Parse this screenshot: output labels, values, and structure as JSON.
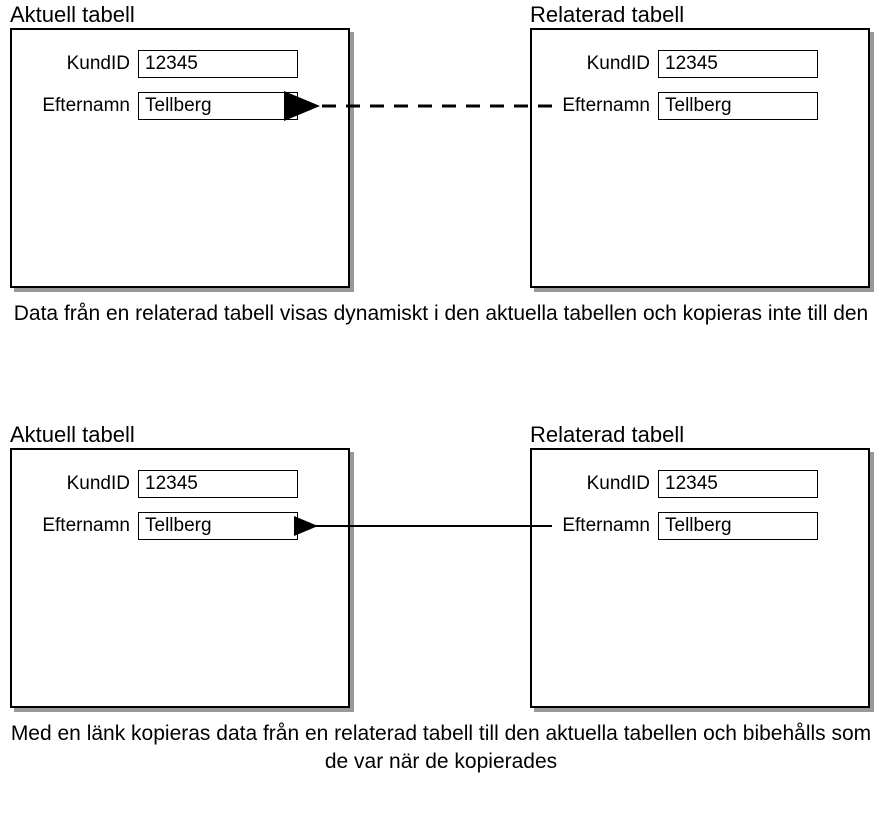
{
  "section1": {
    "leftTitle": "Aktuell tabell",
    "rightTitle": "Relaterad tabell",
    "left": {
      "field1Label": "KundID",
      "field1Value": "12345",
      "field2Label": "Efternamn",
      "field2Value": "Tellberg"
    },
    "right": {
      "field1Label": "KundID",
      "field1Value": "12345",
      "field2Label": "Efternamn",
      "field2Value": "Tellberg"
    },
    "caption": "Data från en relaterad tabell visas dynamiskt i den aktuella tabellen och kopieras inte till den"
  },
  "section2": {
    "leftTitle": "Aktuell tabell",
    "rightTitle": "Relaterad tabell",
    "left": {
      "field1Label": "KundID",
      "field1Value": "12345",
      "field2Label": "Efternamn",
      "field2Value": "Tellberg"
    },
    "right": {
      "field1Label": "KundID",
      "field1Value": "12345",
      "field2Label": "Efternamn",
      "field2Value": "Tellberg"
    },
    "caption": "Med en länk kopieras data från en relaterad tabell till den aktuella tabellen och bibehålls som de var när de kopierades"
  }
}
